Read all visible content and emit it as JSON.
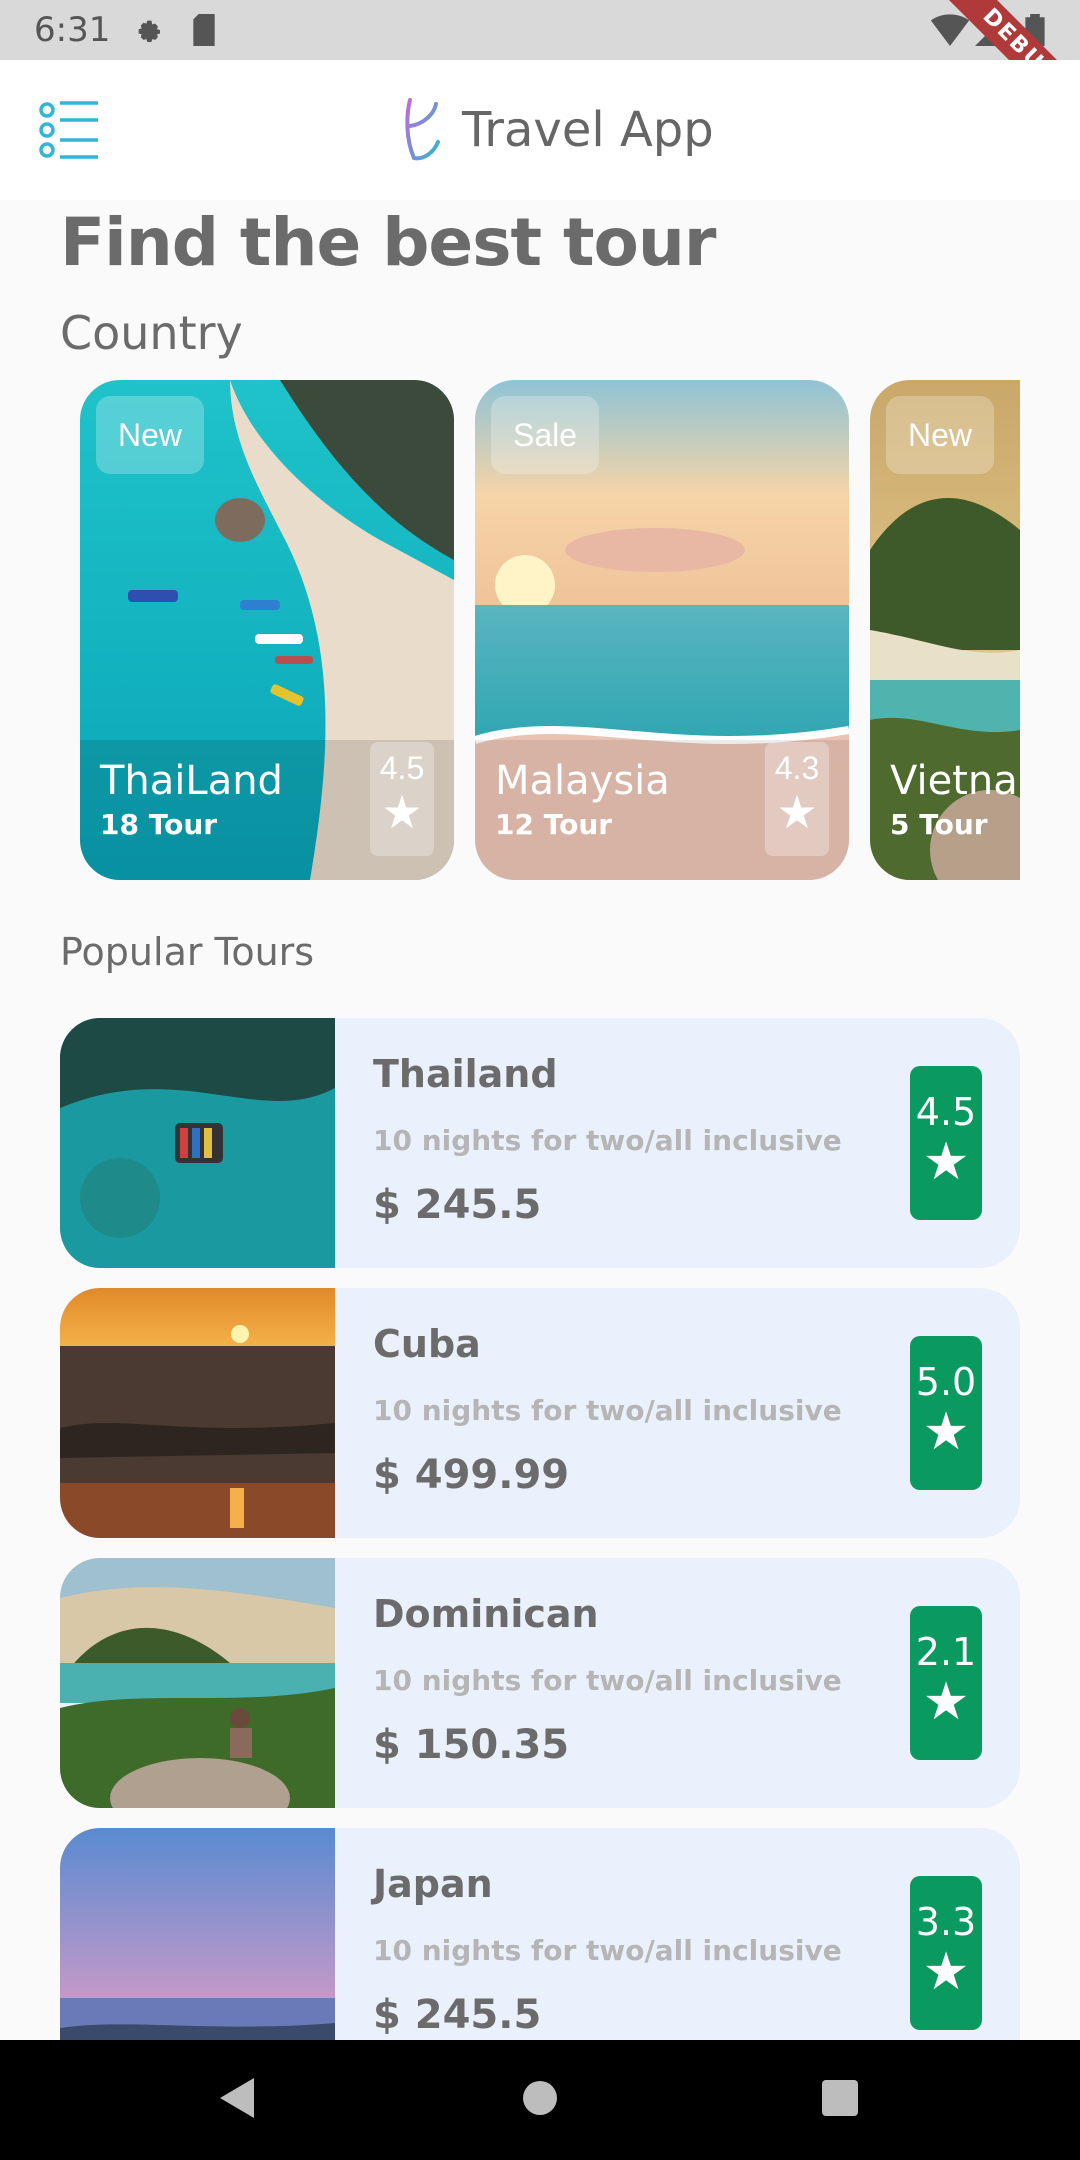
{
  "status_bar": {
    "time": "6:31",
    "debug_label": "DEBUG"
  },
  "app_bar": {
    "title": "Travel App"
  },
  "hero": {
    "title": "Find the best tour"
  },
  "countries": {
    "section_title": "Country",
    "cards": [
      {
        "badge": "New",
        "name": "ThaiLand",
        "tours": "18 Tour",
        "rating": "4.5"
      },
      {
        "badge": "Sale",
        "name": "Malaysia",
        "tours": "12 Tour",
        "rating": "4.3"
      },
      {
        "badge": "New",
        "name": "Vietnam",
        "tours": "5 Tour",
        "rating": ""
      }
    ]
  },
  "popular": {
    "section_title": "Popular Tours",
    "tours": [
      {
        "name": "Thailand",
        "description": "10 nights for two/all inclusive",
        "price": "$ 245.5",
        "rating": "4.5"
      },
      {
        "name": "Cuba",
        "description": "10 nights for two/all inclusive",
        "price": "$ 499.99",
        "rating": "5.0"
      },
      {
        "name": "Dominican",
        "description": "10 nights for two/all inclusive",
        "price": "$ 150.35",
        "rating": "2.1"
      },
      {
        "name": "Japan",
        "description": "10 nights for two/all inclusive",
        "price": "$ 245.5",
        "rating": "3.3"
      }
    ]
  },
  "colors": {
    "accent_green": "#0a9a5f",
    "card_background": "#eaf1fd",
    "menu_icon": "#33b5d6"
  },
  "icons": {
    "menu": "menu-list-icon",
    "star": "star-icon",
    "back": "back-triangle-icon",
    "home": "home-circle-icon",
    "recents": "recents-square-icon"
  }
}
